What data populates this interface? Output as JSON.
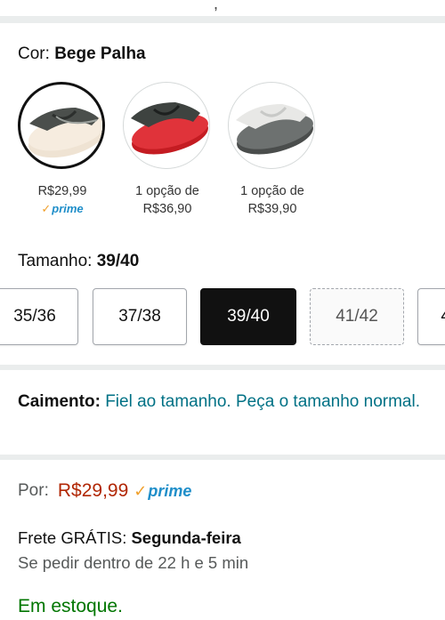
{
  "top_fragment": ",",
  "color": {
    "label": "Cor:",
    "value": "Bege Palha",
    "options": [
      {
        "price": "R$29,99",
        "prime": "prime",
        "selected": true
      },
      {
        "line1": "1 opção de",
        "line2": "R$36,90"
      },
      {
        "line1": "1 opção de",
        "line2": "R$39,90"
      }
    ]
  },
  "size": {
    "label": "Tamanho:",
    "value": "39/40",
    "options": [
      "35/36",
      "37/38",
      "39/40",
      "41/42",
      "4"
    ]
  },
  "fit": {
    "label": "Caimento:",
    "text": "Fiel ao tamanho. Peça o tamanho normal."
  },
  "pricing": {
    "prefix": "Por:",
    "price": "R$29,99",
    "prime": "prime"
  },
  "shipping": {
    "free_label": "Frete GRÁTIS:",
    "day": "Segunda-feira",
    "deadline": "Se pedir dentro de 22 h e 5 min"
  },
  "stock": "Em estoque.",
  "colors": {
    "price_red": "#b12704",
    "teal_link": "#007185",
    "prime_blue": "#1f8ec9",
    "stock_green": "#007600",
    "selected_size_bg": "#111111"
  }
}
